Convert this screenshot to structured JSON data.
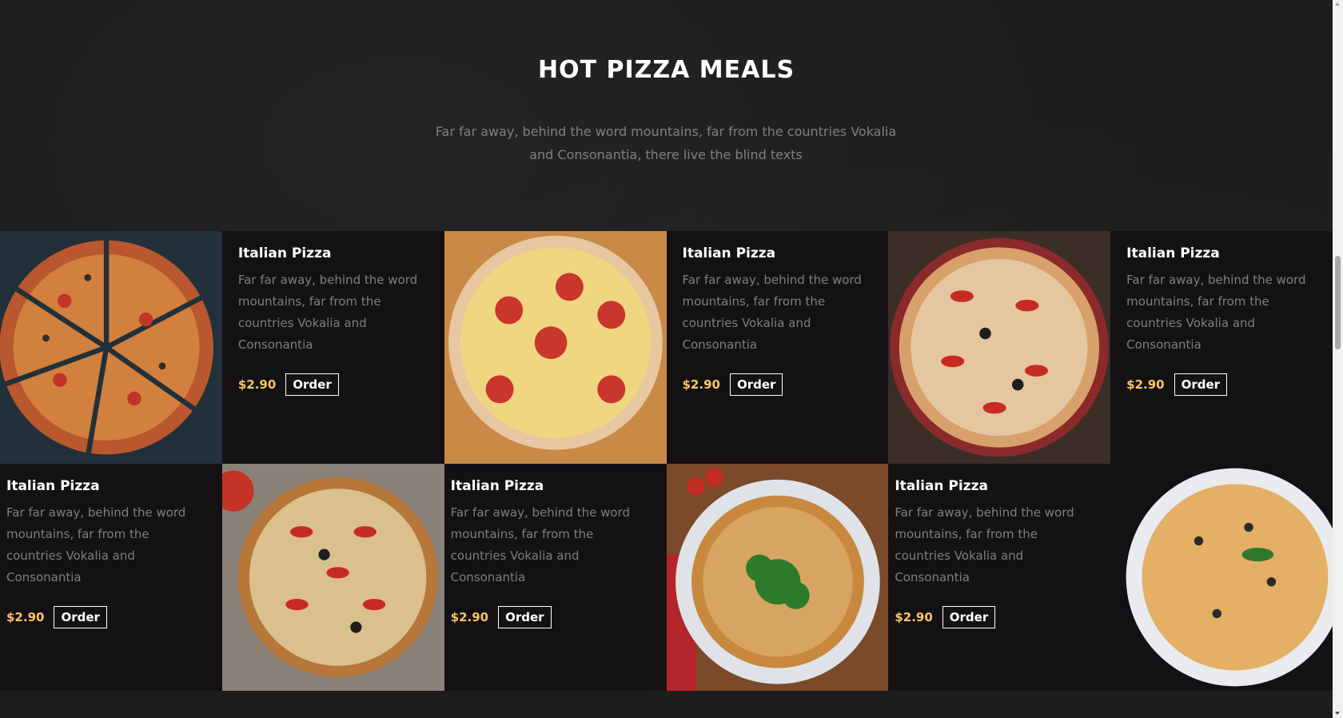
{
  "section": {
    "heading": "HOT PIZZA MEALS",
    "subtitle": "Far far away, behind the word mountains, far from the countries Vokalia and Consonantia, there live the blind texts"
  },
  "items": [
    {
      "title": "Italian Pizza",
      "desc": "Far far away, behind the word mountains, far from the countries Vokalia and Consonantia",
      "price": "$2.90",
      "order": "Order"
    },
    {
      "title": "Italian Pizza",
      "desc": "Far far away, behind the word mountains, far from the countries Vokalia and Consonantia",
      "price": "$2.90",
      "order": "Order"
    },
    {
      "title": "Italian Pizza",
      "desc": "Far far away, behind the word mountains, far from the countries Vokalia and Consonantia",
      "price": "$2.90",
      "order": "Order"
    },
    {
      "title": "Italian Pizza",
      "desc": "Far far away, behind the word mountains, far from the countries Vokalia and Consonantia",
      "price": "$2.90",
      "order": "Order"
    },
    {
      "title": "Italian Pizza",
      "desc": "Far far away, behind the word mountains, far from the countries Vokalia and Consonantia",
      "price": "$2.90",
      "order": "Order"
    },
    {
      "title": "Italian Pizza",
      "desc": "Far far away, behind the word mountains, far from the countries Vokalia and Consonantia",
      "price": "$2.90",
      "order": "Order"
    }
  ],
  "colors": {
    "accent": "#fac564",
    "panel": "#141115",
    "background": "#1c1b1d"
  }
}
